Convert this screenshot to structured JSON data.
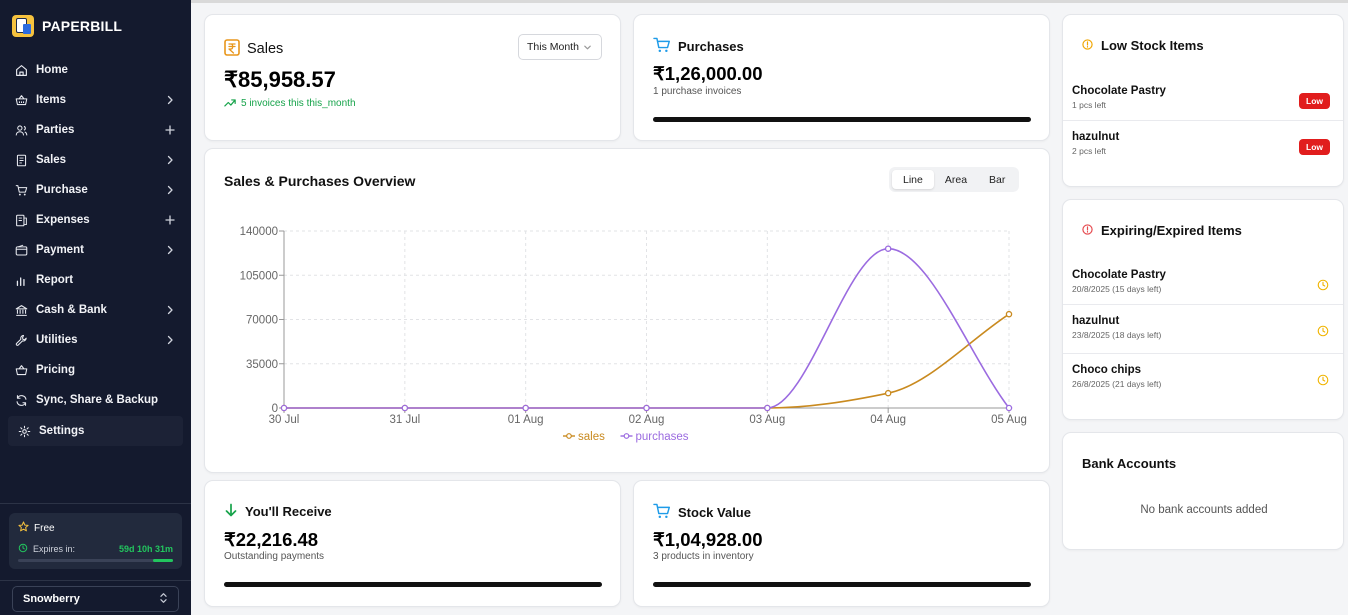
{
  "brand": {
    "name": "PAPERBILL"
  },
  "nav": [
    {
      "label": "Home",
      "icon": "home-icon",
      "trail": ""
    },
    {
      "label": "Items",
      "icon": "basket-icon",
      "trail": "chevron"
    },
    {
      "label": "Parties",
      "icon": "users-icon",
      "trail": "plus"
    },
    {
      "label": "Sales",
      "icon": "receipt-icon",
      "trail": "chevron"
    },
    {
      "label": "Purchase",
      "icon": "cart-icon",
      "trail": "chevron"
    },
    {
      "label": "Expenses",
      "icon": "expense-icon",
      "trail": "plus"
    },
    {
      "label": "Payment",
      "icon": "wallet-icon",
      "trail": "chevron"
    },
    {
      "label": "Report",
      "icon": "report-icon",
      "trail": ""
    },
    {
      "label": "Cash & Bank",
      "icon": "bank-icon",
      "trail": "chevron"
    },
    {
      "label": "Utilities",
      "icon": "wrench-icon",
      "trail": "chevron"
    },
    {
      "label": "Pricing",
      "icon": "pricing-icon",
      "trail": ""
    },
    {
      "label": "Sync, Share & Backup",
      "icon": "sync-icon",
      "trail": ""
    },
    {
      "label": "Settings",
      "icon": "gear-icon",
      "trail": ""
    }
  ],
  "plan": {
    "name": "Free",
    "expires_label": "Expires in:",
    "expires_value": "59d 10h 31m",
    "remaining_fraction": 0.13
  },
  "company": {
    "name": "Snowberry"
  },
  "sales": {
    "title": "Sales",
    "amount": "₹85,958.57",
    "sub": "5 invoices this this_month",
    "period": "This Month"
  },
  "purchases": {
    "title": "Purchases",
    "amount": "₹1,26,000.00",
    "sub": "1 purchase invoices"
  },
  "receive": {
    "title": "You'll Receive",
    "amount": "₹22,216.48",
    "sub": "Outstanding payments"
  },
  "stock": {
    "title": "Stock Value",
    "amount": "₹1,04,928.00",
    "sub": "3 products in inventory"
  },
  "overview": {
    "title": "Sales & Purchases Overview",
    "tabs": [
      "Line",
      "Area",
      "Bar"
    ],
    "active_tab": "Line"
  },
  "low_stock": {
    "title": "Low Stock Items",
    "items": [
      {
        "name": "Chocolate Pastry",
        "sub": "1 pcs left",
        "badge": "Low"
      },
      {
        "name": "hazulnut",
        "sub": "2 pcs left",
        "badge": "Low"
      }
    ]
  },
  "expiring": {
    "title": "Expiring/Expired Items",
    "items": [
      {
        "name": "Chocolate Pastry",
        "sub": "20/8/2025 (15 days left)"
      },
      {
        "name": "hazulnut",
        "sub": "23/8/2025 (18 days left)"
      },
      {
        "name": "Choco chips",
        "sub": "26/8/2025 (21 days left)"
      }
    ]
  },
  "bank": {
    "title": "Bank Accounts",
    "empty": "No bank accounts added"
  },
  "colors": {
    "sales": "#c98a1f",
    "purchases": "#9b6be0",
    "sidebar": "#141a2e",
    "accent_green": "#16a34a",
    "low_badge": "#e11d1d"
  },
  "chart_data": {
    "type": "line",
    "x": [
      "30 Jul",
      "31 Jul",
      "01 Aug",
      "02 Aug",
      "03 Aug",
      "04 Aug",
      "05 Aug"
    ],
    "series": [
      {
        "name": "sales",
        "values": [
          0,
          0,
          0,
          0,
          0,
          11742.09,
          74216.48
        ]
      },
      {
        "name": "purchases",
        "values": [
          0,
          0,
          0,
          0,
          0,
          126000,
          0
        ]
      }
    ],
    "yticks": [
      0,
      35000,
      70000,
      105000,
      140000
    ],
    "ylim": [
      0,
      140000
    ],
    "grid": true,
    "legend": "bottom"
  }
}
